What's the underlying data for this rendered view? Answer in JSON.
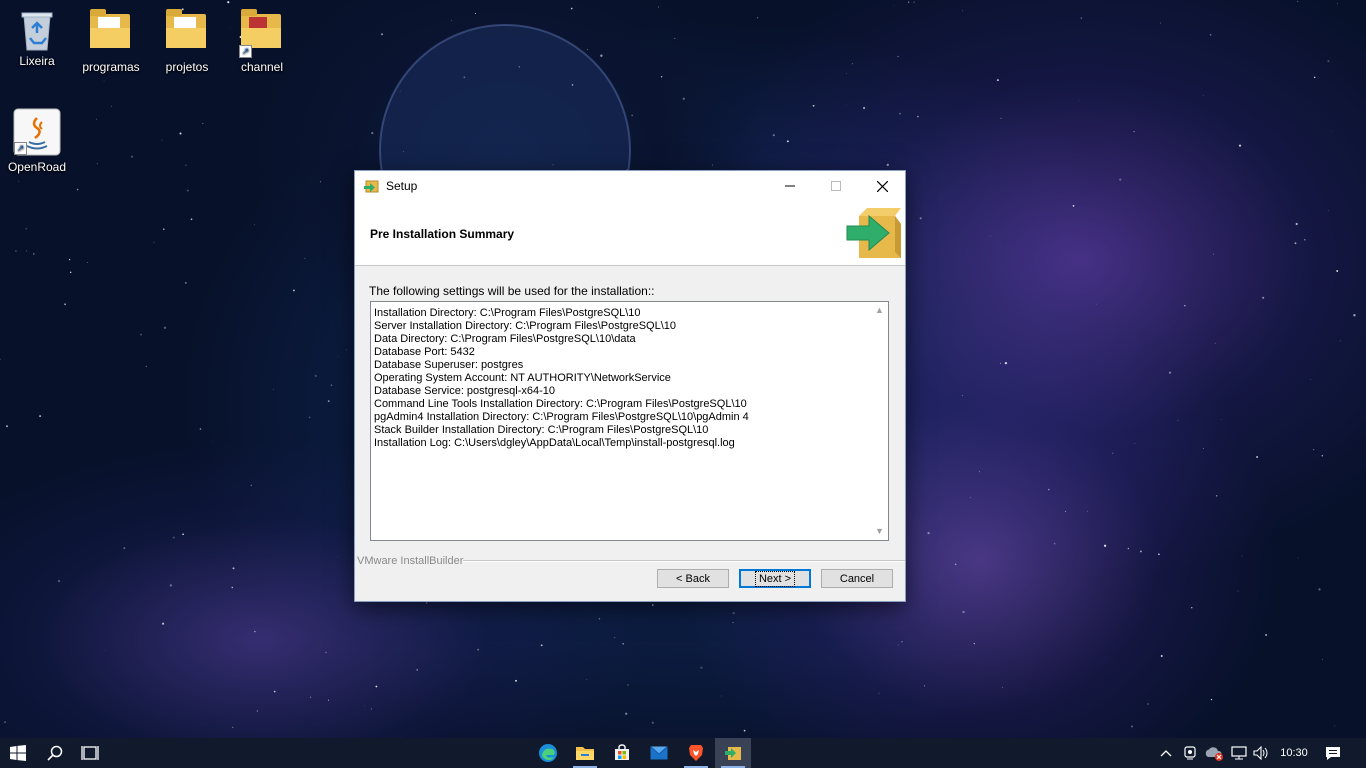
{
  "desktop": {
    "icons": [
      {
        "label": "Lixeira",
        "icon": "recycle-bin-icon"
      },
      {
        "label": "programas",
        "icon": "folder-icon"
      },
      {
        "label": "projetos",
        "icon": "folder-icon"
      },
      {
        "label": "channel",
        "icon": "folder-shortcut-icon"
      },
      {
        "label": "OpenRoad",
        "icon": "java-shortcut-icon"
      }
    ]
  },
  "dialog": {
    "title": "Setup",
    "header_title": "Pre Installation Summary",
    "intro": "The following settings will be used for the installation::",
    "summary_lines": [
      "Installation Directory: C:\\Program Files\\PostgreSQL\\10",
      "Server Installation Directory: C:\\Program Files\\PostgreSQL\\10",
      "Data Directory: C:\\Program Files\\PostgreSQL\\10\\data",
      "Database Port: 5432",
      "Database Superuser: postgres",
      "Operating System Account: NT AUTHORITY\\NetworkService",
      "Database Service: postgresql-x64-10",
      "Command Line Tools Installation Directory: C:\\Program Files\\PostgreSQL\\10",
      "pgAdmin4 Installation Directory: C:\\Program Files\\PostgreSQL\\10\\pgAdmin 4",
      "Stack Builder Installation Directory: C:\\Program Files\\PostgreSQL\\10",
      "Installation Log: C:\\Users\\dgley\\AppData\\Local\\Temp\\install-postgresql.log"
    ],
    "brand": "VMware InstallBuilder",
    "buttons": {
      "back": "< Back",
      "next": "Next >",
      "cancel": "Cancel"
    }
  },
  "taskbar": {
    "apps": [
      "start-icon",
      "search-icon",
      "task-view-icon",
      "edge-icon",
      "file-explorer-icon",
      "store-icon",
      "mail-icon",
      "brave-icon",
      "setup-installer-icon"
    ],
    "clock": "10:30"
  }
}
